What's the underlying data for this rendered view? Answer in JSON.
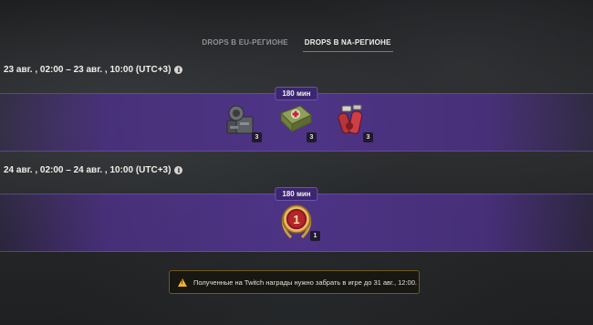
{
  "tabs": [
    {
      "label": "DROPS В EU-РЕГИОНЕ",
      "active": false
    },
    {
      "label": "DROPS В NA-РЕГИОНЕ",
      "active": true
    }
  ],
  "slots": [
    {
      "title": "23 авг. , 02:00 – 23 авг. , 10:00 (UTC+3)",
      "duration": "180 мин",
      "rewards": [
        {
          "icon": "equipment-kit-icon",
          "count": "3"
        },
        {
          "icon": "first-aid-kit-icon",
          "count": "3"
        },
        {
          "icon": "fire-extinguisher-icon",
          "count": "3"
        }
      ]
    },
    {
      "title": "24 авг. , 02:00 – 24 авг. , 10:00 (UTC+3)",
      "duration": "180 мин",
      "rewards": [
        {
          "icon": "personal-mission-medal-icon",
          "count": "1",
          "medal_number": "1"
        }
      ]
    }
  ],
  "notice": {
    "text": "Полученные на Twitch награды нужно забрать в игре до 31 авг., 12:00.",
    "icon": "warning-icon"
  },
  "colors": {
    "accent": "#e0523a",
    "band": "#50348a",
    "warning": "#f0b429"
  }
}
